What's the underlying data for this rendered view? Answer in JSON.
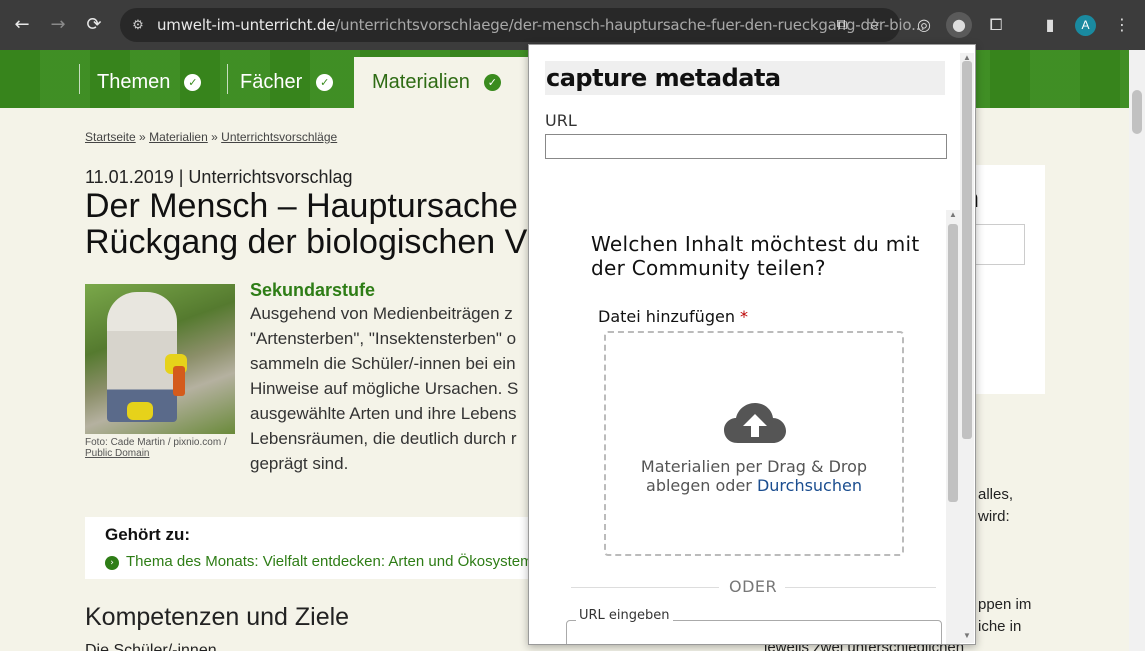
{
  "browser": {
    "url_domain": "umwelt-im-unterricht.de",
    "url_path": "/unterrichtsvorschlaege/der-mensch-hauptursache-fuer-den-rueckgang-der-bio...",
    "avatar_letter": "A",
    "icons": [
      "back-icon",
      "forward-icon",
      "reload-icon",
      "site-info-icon",
      "translate-icon",
      "star-icon",
      "extension-icon",
      "capture-extension-icon",
      "puzzle-icon",
      "sidepanel-icon",
      "menu-icon"
    ]
  },
  "site_nav": {
    "items": [
      {
        "label": "Themen"
      },
      {
        "label": "Fächer"
      },
      {
        "label": "Materialien"
      }
    ]
  },
  "article": {
    "breadcrumb": [
      "Startseite",
      "Materialien",
      "Unterrichtsvorschläge"
    ],
    "breadcrumb_sep": "»",
    "date_line": "11.01.2019 | Unterrichtsvorschlag",
    "title_line1": "Der Mensch – Hauptursache",
    "title_line2": "Rückgang der biologischen V",
    "photo_caption_line1": "Foto: Cade Martin / pixnio.com /",
    "photo_caption_link": "Public Domain",
    "level": "Sekundarstufe",
    "body": [
      "Ausgehend von Medienbeiträgen z",
      "\"Artensterben\", \"Insektensterben\" o",
      "sammeln die Schüler/-innen bei ein",
      "Hinweise auf mögliche Ursachen. S",
      "ausgewählte Arten und ihre Lebens",
      "Lebensräumen, die deutlich durch r",
      "geprägt sind."
    ],
    "belongs_title": "Gehört zu:",
    "belongs_link": "Thema des Monats: Vielfalt entdecken: Arten und Ökosystem",
    "section_heading": "Kompetenzen und Ziele",
    "section_text": "Die Schüler/-innen"
  },
  "sidebar": {
    "heading_fragment": "n",
    "right_texts": [
      {
        "text": "alles,"
      },
      {
        "text": "wird:"
      },
      {
        "text": "ppen im"
      },
      {
        "text": "iche in"
      },
      {
        "text": "jeweils zwei unterschiedlichen"
      }
    ]
  },
  "popup": {
    "title": "capture metadata",
    "url_label": "URL",
    "url_value": "",
    "share_heading": "Welchen Inhalt möchtest du mit der Community teilen?",
    "file_label": "Datei hinzufügen",
    "required_mark": "*",
    "drop_text_line1": "Materialien per Drag & Drop",
    "drop_text_line2": "ablegen oder",
    "browse_link": "Durchsuchen",
    "or_text": "ODER",
    "url_input_label": "URL eingeben",
    "url_input_value": ""
  },
  "colors": {
    "header_green": "#3a8b1e",
    "link_green": "#2e7d16",
    "browse_blue": "#1a4d8f"
  }
}
